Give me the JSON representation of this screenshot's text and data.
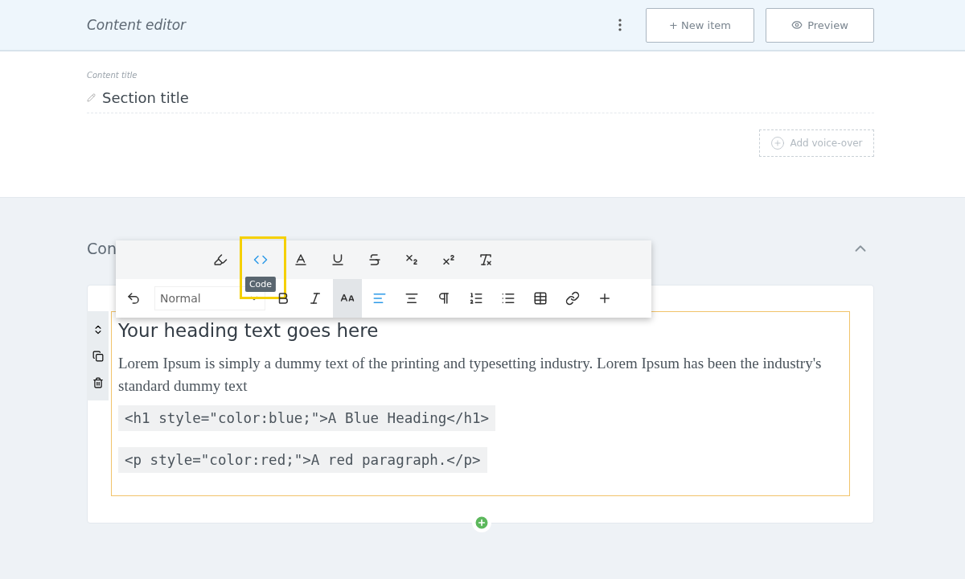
{
  "header": {
    "title": "Content editor",
    "buttons": [
      {
        "kind": "new",
        "label": "+ New item"
      },
      {
        "kind": "preview",
        "label": "Preview"
      }
    ]
  },
  "content_title": {
    "label": "Content title",
    "value": "Section title"
  },
  "voice_over": {
    "label": "Add voice-over"
  },
  "section": {
    "title": "Con",
    "expanded": true
  },
  "toolbar": {
    "rows": [
      [
        {
          "kind": "highlighter",
          "active": false,
          "highlighted": false
        },
        {
          "kind": "code",
          "active": true,
          "highlighted": true,
          "tooltip": "Code"
        },
        {
          "kind": "font-color",
          "active": false,
          "highlighted": false
        },
        {
          "kind": "underline",
          "active": false,
          "highlighted": false
        },
        {
          "kind": "strike",
          "active": false,
          "highlighted": false
        },
        {
          "kind": "subscript",
          "active": false,
          "highlighted": false
        },
        {
          "kind": "superscript",
          "active": false,
          "highlighted": false
        },
        {
          "kind": "clear-format",
          "active": false,
          "highlighted": false
        }
      ],
      [
        {
          "kind": "undo",
          "active": false,
          "highlighted": false
        },
        {
          "kind": "select",
          "value": "Normal"
        },
        {
          "kind": "bold",
          "active": false,
          "highlighted": false
        },
        {
          "kind": "italic",
          "active": false,
          "highlighted": false
        },
        {
          "kind": "font-size",
          "active": true,
          "highlighted": false
        },
        {
          "kind": "align-left",
          "active": true,
          "highlighted": false
        },
        {
          "kind": "align-center",
          "active": false,
          "highlighted": false
        },
        {
          "kind": "paragraph",
          "active": false,
          "highlighted": false
        },
        {
          "kind": "ordered-list",
          "active": false,
          "highlighted": false
        },
        {
          "kind": "bullet-list",
          "active": false,
          "highlighted": false
        },
        {
          "kind": "table",
          "active": false,
          "highlighted": false
        },
        {
          "kind": "link",
          "active": false,
          "highlighted": false
        },
        {
          "kind": "more",
          "active": false,
          "highlighted": false
        }
      ]
    ]
  },
  "block": {
    "heading": "Your heading text goes here",
    "paragraph": "Lorem Ipsum is simply a dummy text of the printing and typesetting industry. Lorem Ipsum has been the industry's standard dummy text",
    "code": [
      "<h1 style=\"color:blue;\">A Blue Heading</h1>",
      "<p style=\"color:red;\">A red paragraph.</p>"
    ]
  }
}
